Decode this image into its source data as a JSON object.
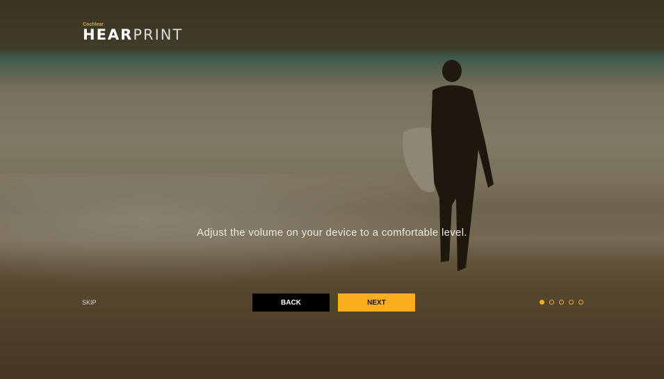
{
  "logo": {
    "brand": "Cochlear",
    "name_bold": "HEAR",
    "name_light": "PRINT"
  },
  "message": "Adjust the volume on your device to a comfortable level.",
  "buttons": {
    "skip": "SKIP",
    "back": "BACK",
    "next": "NEXT"
  },
  "pagination": {
    "total": 5,
    "current": 1
  },
  "colors": {
    "accent": "#f8ae1f",
    "back_button": "#000000"
  }
}
